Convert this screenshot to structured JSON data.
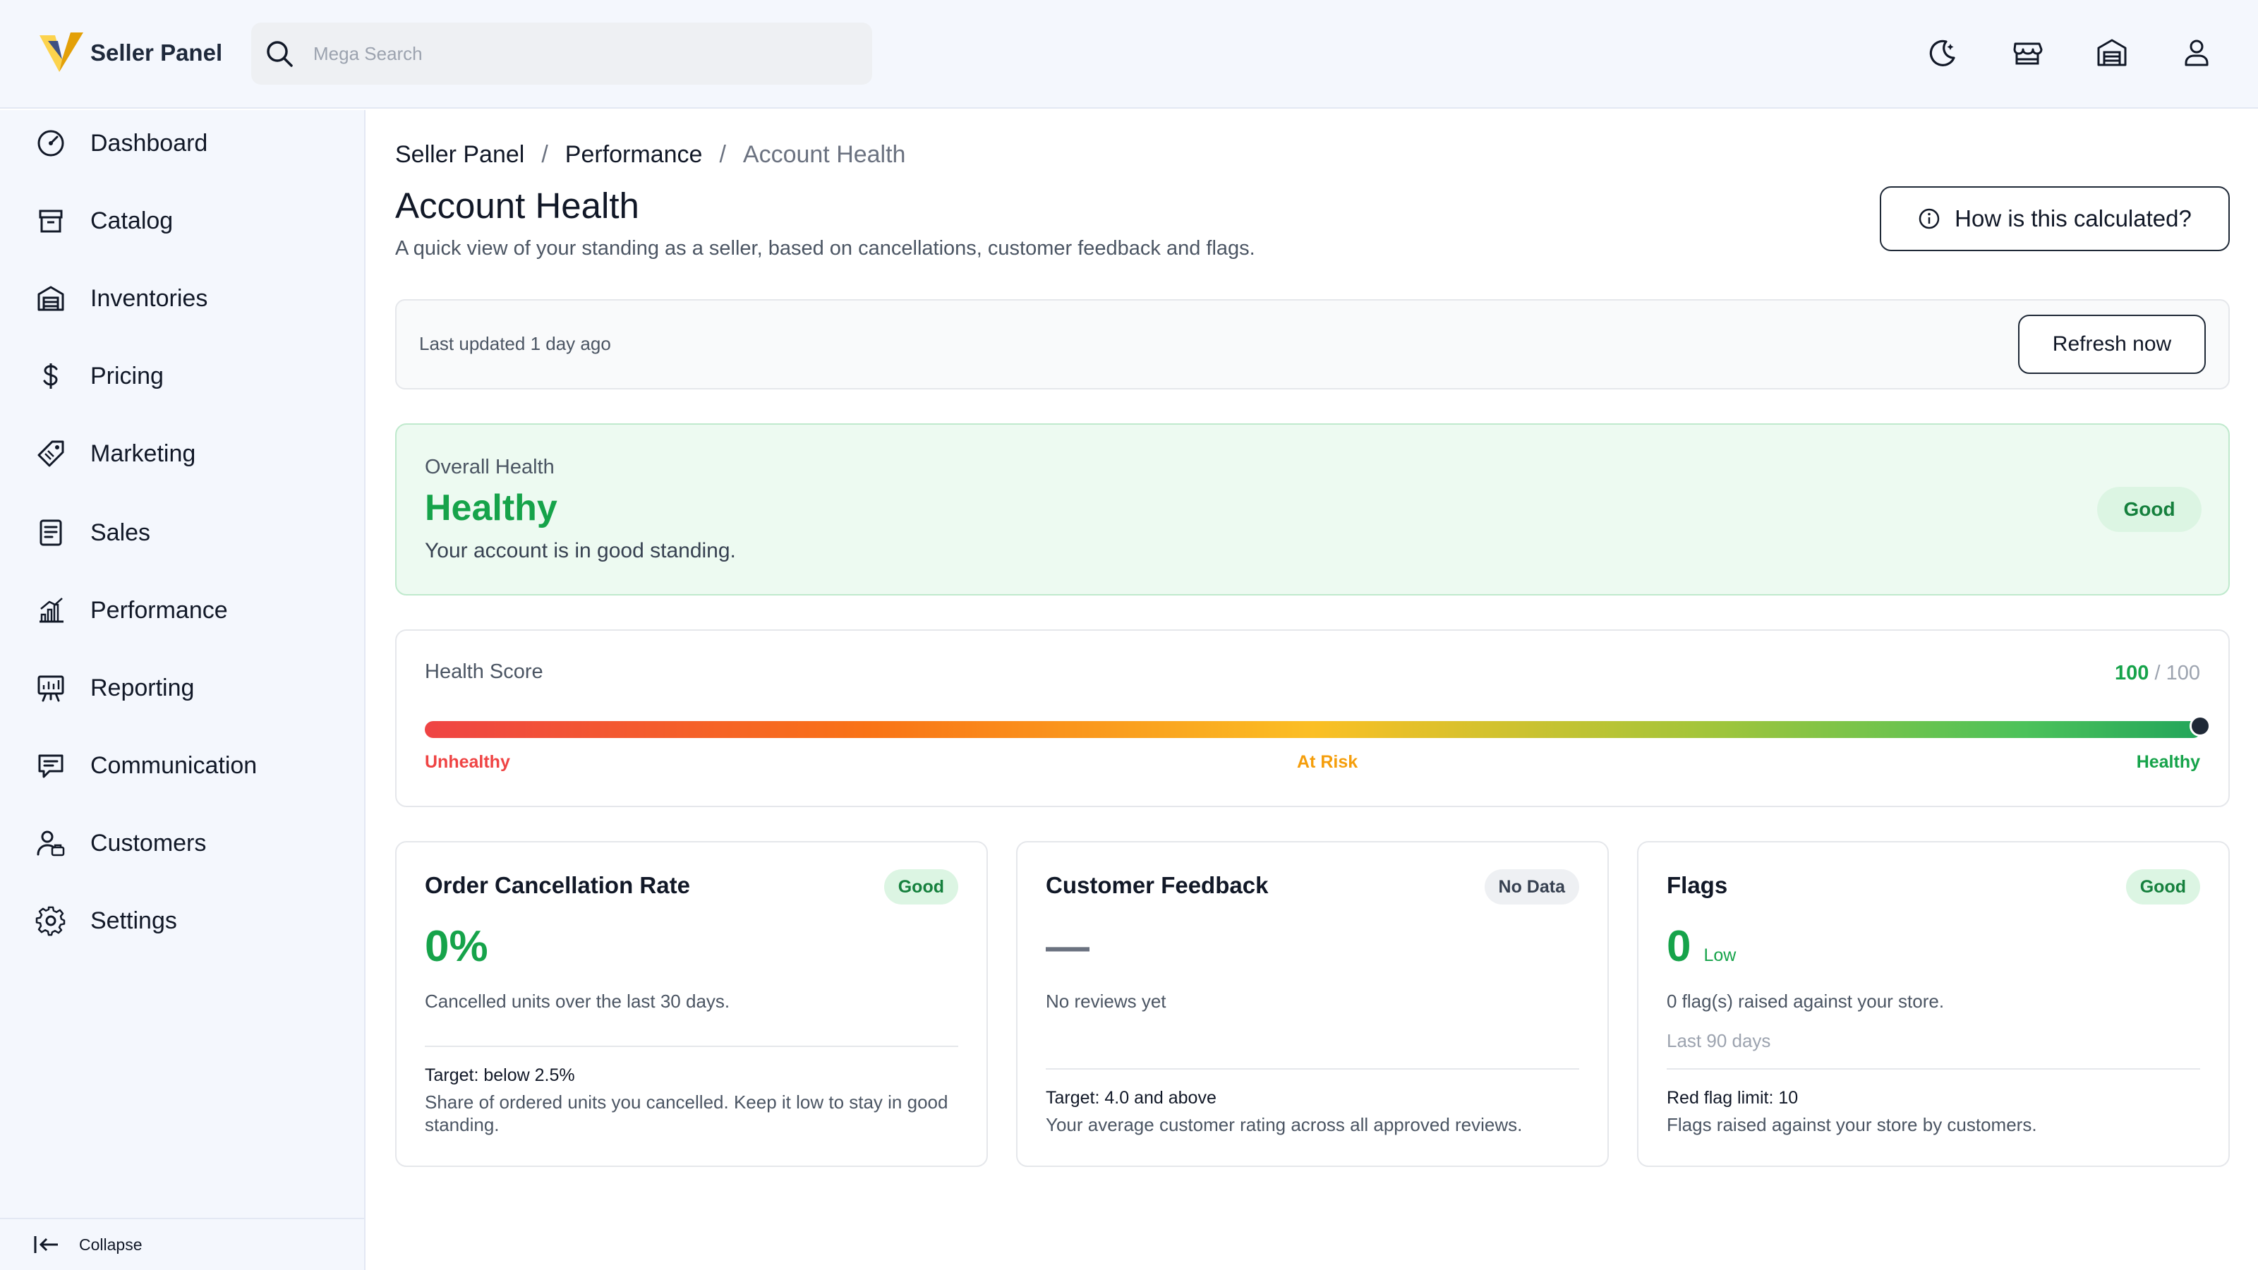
{
  "app": {
    "name": "Seller Panel"
  },
  "search": {
    "placeholder": "Mega Search"
  },
  "header_icons": [
    "moon-icon",
    "store-icon",
    "warehouse-icon",
    "user-icon"
  ],
  "sidebar": {
    "items": [
      {
        "label": "Dashboard",
        "icon": "dashboard-gauge-icon"
      },
      {
        "label": "Catalog",
        "icon": "box-icon"
      },
      {
        "label": "Inventories",
        "icon": "warehouse-icon"
      },
      {
        "label": "Pricing",
        "icon": "dollar-icon"
      },
      {
        "label": "Marketing",
        "icon": "tag-icon"
      },
      {
        "label": "Sales",
        "icon": "receipt-icon"
      },
      {
        "label": "Performance",
        "icon": "bar-chart-icon"
      },
      {
        "label": "Reporting",
        "icon": "presentation-icon"
      },
      {
        "label": "Communication",
        "icon": "message-icon"
      },
      {
        "label": "Customers",
        "icon": "users-icon"
      },
      {
        "label": "Settings",
        "icon": "gear-icon"
      }
    ],
    "collapse_label": "Collapse"
  },
  "breadcrumb": {
    "items": [
      "Seller Panel",
      "Performance"
    ],
    "current": "Account Health",
    "separator": "/"
  },
  "page": {
    "title": "Account Health",
    "subtitle": "A quick view of your standing as a seller, based on cancellations, customer feedback and flags.",
    "help_button": "How is this calculated?"
  },
  "update": {
    "text": "Last updated 1 day ago",
    "refresh_label": "Refresh now"
  },
  "overall": {
    "label": "Overall Health",
    "status": "Healthy",
    "description": "Your account is in good standing.",
    "badge": "Good"
  },
  "health_score": {
    "label": "Health Score",
    "value": "100",
    "max": "/ 100",
    "fraction": 1.0,
    "scale": {
      "low": "Unhealthy",
      "mid": "At Risk",
      "high": "Healthy"
    }
  },
  "metrics": {
    "cancellation": {
      "title": "Order Cancellation Rate",
      "badge": "Good",
      "value": "0%",
      "description": "Cancelled units over the last 30 days.",
      "target": "Target: below 2.5%",
      "note": "Share of ordered units you cancelled. Keep it low to stay in good standing."
    },
    "feedback": {
      "title": "Customer Feedback",
      "badge": "No Data",
      "value": "—",
      "description": "No reviews yet",
      "target": "Target: 4.0 and above",
      "note": "Your average customer rating across all approved reviews."
    },
    "flags": {
      "title": "Flags",
      "badge": "Good",
      "value": "0",
      "value_sub": "Low",
      "description": "0 flag(s) raised against your store.",
      "period": "Last 90 days",
      "target": "Red flag limit: 10",
      "note": "Flags raised against your store by customers."
    }
  },
  "colors": {
    "good": "#16a34a",
    "good_bg": "#edfaf1",
    "unhealthy": "#ef4444",
    "at_risk": "#f59e0b",
    "brand_v_dark": "#e3a008",
    "brand_v_light": "#fcd34d"
  }
}
